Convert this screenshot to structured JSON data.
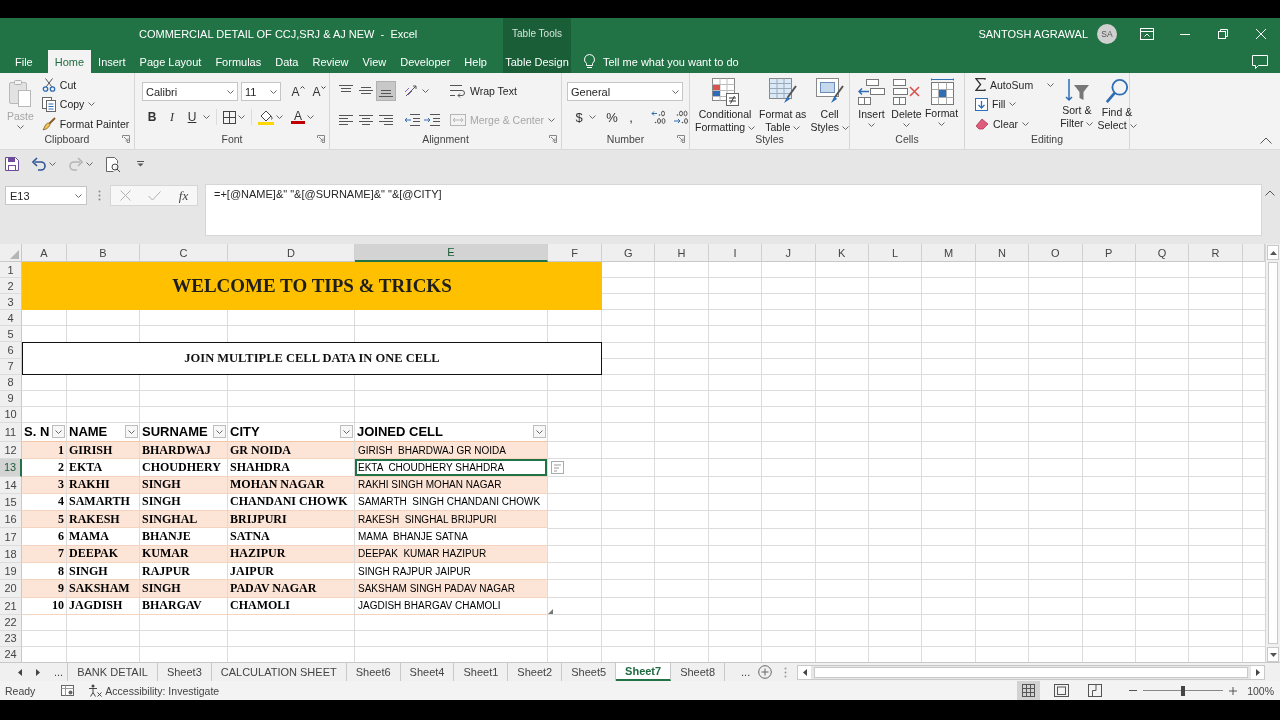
{
  "window": {
    "title": "COMMERCIAL DETAIL OF CCJ,SRJ & AJ NEW  -  Excel",
    "context_label": "Table Tools",
    "user_name": "SANTOSH AGRAWAL",
    "user_initials": "SA"
  },
  "ribbon_tabs": [
    {
      "label": "File",
      "kind": "standard",
      "selected": false
    },
    {
      "label": "Home",
      "kind": "standard",
      "selected": true
    },
    {
      "label": "Insert",
      "kind": "standard",
      "selected": false
    },
    {
      "label": "Page Layout",
      "kind": "standard",
      "selected": false
    },
    {
      "label": "Formulas",
      "kind": "standard",
      "selected": false
    },
    {
      "label": "Data",
      "kind": "standard",
      "selected": false
    },
    {
      "label": "Review",
      "kind": "standard",
      "selected": false
    },
    {
      "label": "View",
      "kind": "standard",
      "selected": false
    },
    {
      "label": "Developer",
      "kind": "standard",
      "selected": false
    },
    {
      "label": "Help",
      "kind": "standard",
      "selected": false
    },
    {
      "label": "Table Design",
      "kind": "contextual",
      "selected": false
    }
  ],
  "tell_me": {
    "placeholder": "Tell me what you want to do"
  },
  "ribbon": {
    "clipboard": {
      "title": "Clipboard",
      "paste": {
        "label": "Paste",
        "disabled": true
      },
      "cut": "Cut",
      "copy": "Copy",
      "format_painter": "Format Painter"
    },
    "font": {
      "title": "Font",
      "name": "Calibri",
      "size": "11",
      "grow_label": "A",
      "shrink_label": "A",
      "bold_label": "B",
      "italic_label": "I",
      "underline_label": "U",
      "font_color_label": "A"
    },
    "alignment": {
      "title": "Alignment",
      "vertical": [
        {
          "selected": false
        },
        {
          "selected": false
        },
        {
          "selected": true
        }
      ],
      "wrap_text": "Wrap Text",
      "merge": {
        "label": "Merge & Center",
        "disabled": true
      }
    },
    "number": {
      "title": "Number",
      "format": "General",
      "currency": "$",
      "percent": "%",
      "comma": ","
    },
    "styles": {
      "title": "Styles",
      "buttons": [
        {
          "lines": [
            "Conditional",
            "Formatting"
          ]
        },
        {
          "lines": [
            "Format as",
            "Table"
          ]
        },
        {
          "lines": [
            "Cell",
            "Styles"
          ]
        }
      ]
    },
    "cells": {
      "title": "Cells",
      "buttons": [
        "Insert",
        "Delete",
        "Format"
      ]
    },
    "editing": {
      "title": "Editing",
      "autosum": "AutoSum",
      "fill": "Fill",
      "clear": "Clear",
      "buttons": [
        {
          "lines": [
            "Sort &",
            "Filter"
          ]
        },
        {
          "lines": [
            "Find &",
            "Select"
          ]
        }
      ]
    }
  },
  "quick_access": {
    "redo": {
      "disabled": true
    }
  },
  "formula_bar": {
    "name_box": "E13",
    "edit_disabled": true,
    "function_label": "fx",
    "formula": "=+[@NAME]&\" \"&[@SURNAME]&\" \"&[@CITY]"
  },
  "sheet": {
    "columns": [
      {
        "label": "A",
        "selected": false
      },
      {
        "label": "B",
        "selected": false
      },
      {
        "label": "C",
        "selected": false
      },
      {
        "label": "D",
        "selected": false
      },
      {
        "label": "E",
        "selected": true
      },
      {
        "label": "F",
        "selected": false
      },
      {
        "label": "G",
        "selected": false
      },
      {
        "label": "H",
        "selected": false
      },
      {
        "label": "I",
        "selected": false
      },
      {
        "label": "J",
        "selected": false
      },
      {
        "label": "K",
        "selected": false
      },
      {
        "label": "L",
        "selected": false
      },
      {
        "label": "M",
        "selected": false
      },
      {
        "label": "N",
        "selected": false
      },
      {
        "label": "O",
        "selected": false
      },
      {
        "label": "P",
        "selected": false
      },
      {
        "label": "Q",
        "selected": false
      },
      {
        "label": "R",
        "selected": false
      }
    ],
    "rows": [
      {
        "label": "1",
        "selected": false
      },
      {
        "label": "2",
        "selected": false
      },
      {
        "label": "3",
        "selected": false
      },
      {
        "label": "4",
        "selected": false
      },
      {
        "label": "5",
        "selected": false
      },
      {
        "label": "6",
        "selected": false
      },
      {
        "label": "7",
        "selected": false
      },
      {
        "label": "8",
        "selected": false
      },
      {
        "label": "9",
        "selected": false
      },
      {
        "label": "10",
        "selected": false
      },
      {
        "label": "11",
        "selected": false
      },
      {
        "label": "12",
        "selected": false
      },
      {
        "label": "13",
        "selected": true
      },
      {
        "label": "14",
        "selected": false
      },
      {
        "label": "15",
        "selected": false
      },
      {
        "label": "16",
        "selected": false
      },
      {
        "label": "17",
        "selected": false
      },
      {
        "label": "18",
        "selected": false
      },
      {
        "label": "19",
        "selected": false
      },
      {
        "label": "20",
        "selected": false
      },
      {
        "label": "21",
        "selected": false
      },
      {
        "label": "22",
        "selected": false
      },
      {
        "label": "23",
        "selected": false
      },
      {
        "label": "24",
        "selected": false
      }
    ],
    "banner": "WELCOME TO TIPS & TRICKS",
    "subtitle": "JOIN MULTIPLE CELL DATA IN ONE CELL",
    "table": {
      "banded_rows": true,
      "headers": [
        "S. N",
        "NAME",
        "SURNAME",
        "CITY",
        "JOINED CELL"
      ],
      "rows": [
        {
          "cells": [
            "1",
            "GIRISH",
            "BHARDWAJ",
            "GR NOIDA",
            "GIRISH  BHARDWAJ GR NOIDA"
          ],
          "selected": false
        },
        {
          "cells": [
            "2",
            "EKTA",
            "CHOUDHERY",
            "SHAHDRA",
            "EKTA  CHOUDHERY SHAHDRA"
          ],
          "selected": true
        },
        {
          "cells": [
            "3",
            "RAKHI",
            "SINGH",
            "MOHAN NAGAR",
            "RAKHI SINGH MOHAN NAGAR"
          ],
          "selected": false
        },
        {
          "cells": [
            "4",
            "SAMARTH",
            "SINGH",
            "CHANDANI CHOWK",
            "SAMARTH  SINGH CHANDANI CHOWK"
          ],
          "selected": false
        },
        {
          "cells": [
            "5",
            "RAKESH",
            "SINGHAL",
            "BRIJPURI",
            "RAKESH  SINGHAL BRIJPURI"
          ],
          "selected": false
        },
        {
          "cells": [
            "6",
            "MAMA",
            "BHANJE",
            "SATNA",
            "MAMA  BHANJE SATNA"
          ],
          "selected": false
        },
        {
          "cells": [
            "7",
            "DEEPAK",
            "KUMAR",
            "HAZIPUR",
            "DEEPAK  KUMAR HAZIPUR"
          ],
          "selected": false
        },
        {
          "cells": [
            "8",
            "SINGH",
            "RAJPUR",
            "JAIPUR",
            "SINGH RAJPUR JAIPUR"
          ],
          "selected": false
        },
        {
          "cells": [
            "9",
            "SAKSHAM",
            "SINGH",
            "PADAV NAGAR",
            "SAKSHAM SINGH PADAV NAGAR"
          ],
          "selected": false
        },
        {
          "cells": [
            "10",
            "JAGDISH",
            "BHARGAV",
            "CHAMOLI",
            "JAGDISH BHARGAV CHAMOLI"
          ],
          "selected": false
        }
      ]
    }
  },
  "sheet_tabs": {
    "more_left": "...",
    "tabs": [
      {
        "label": "BANK DETAIL",
        "selected": false
      },
      {
        "label": "Sheet3",
        "selected": false
      },
      {
        "label": "CALCULATION SHEET",
        "selected": false
      },
      {
        "label": "Sheet6",
        "selected": false
      },
      {
        "label": "Sheet4",
        "selected": false
      },
      {
        "label": "Sheet1",
        "selected": false
      },
      {
        "label": "Sheet2",
        "selected": false
      },
      {
        "label": "Sheet5",
        "selected": false
      },
      {
        "label": "Sheet7",
        "selected": true
      },
      {
        "label": "Sheet8",
        "selected": false
      }
    ],
    "more_right": "..."
  },
  "status_bar": {
    "status": "Ready",
    "accessibility": "Accessibility: Investigate",
    "views": [
      {
        "selected": true
      },
      {
        "selected": false
      },
      {
        "selected": false
      }
    ],
    "zoom": {
      "level": 0.5,
      "reading": "100%"
    }
  }
}
